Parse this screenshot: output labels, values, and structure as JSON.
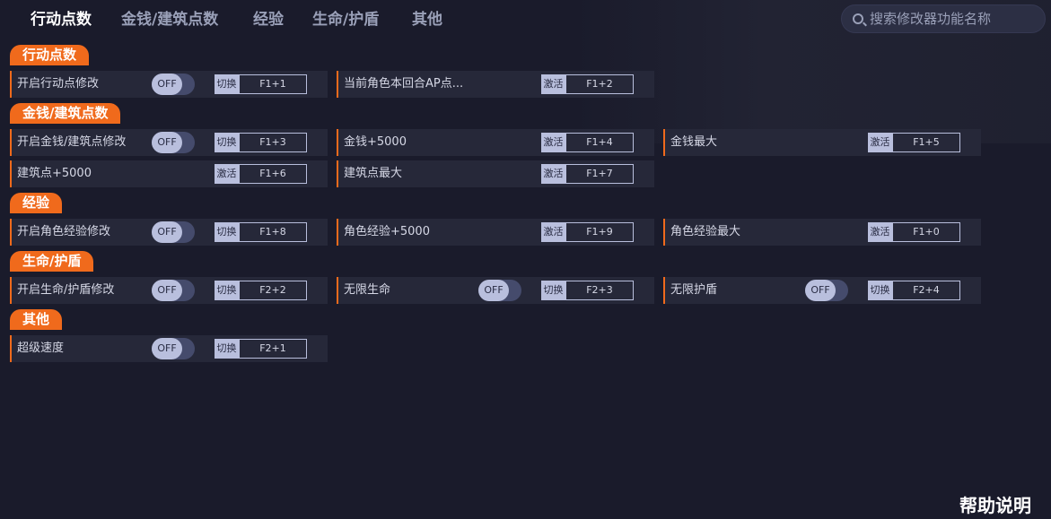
{
  "tabs": [
    "行动点数",
    "金钱/建筑点数",
    "经验",
    "生命/护盾",
    "其他"
  ],
  "search": {
    "placeholder": "搜索修改器功能名称"
  },
  "toggle_text": "OFF",
  "sections": [
    {
      "title": "行动点数",
      "rows": [
        [
          {
            "label": "开启行动点修改",
            "toggle": true,
            "type": "切换",
            "key": "F1+1"
          },
          {
            "label": "当前角色本回合AP点...",
            "toggle": false,
            "type": "激活",
            "key": "F1+2"
          }
        ]
      ]
    },
    {
      "title": "金钱/建筑点数",
      "rows": [
        [
          {
            "label": "开启金钱/建筑点修改",
            "toggle": true,
            "type": "切换",
            "key": "F1+3"
          },
          {
            "label": "金钱+5000",
            "toggle": false,
            "type": "激活",
            "key": "F1+4"
          },
          {
            "label": "金钱最大",
            "toggle": false,
            "type": "激活",
            "key": "F1+5"
          }
        ],
        [
          {
            "label": "建筑点+5000",
            "toggle": false,
            "type": "激活",
            "key": "F1+6"
          },
          {
            "label": "建筑点最大",
            "toggle": false,
            "type": "激活",
            "key": "F1+7"
          }
        ]
      ]
    },
    {
      "title": "经验",
      "rows": [
        [
          {
            "label": "开启角色经验修改",
            "toggle": true,
            "type": "切换",
            "key": "F1+8"
          },
          {
            "label": "角色经验+5000",
            "toggle": false,
            "type": "激活",
            "key": "F1+9"
          },
          {
            "label": "角色经验最大",
            "toggle": false,
            "type": "激活",
            "key": "F1+0"
          }
        ]
      ]
    },
    {
      "title": "生命/护盾",
      "rows": [
        [
          {
            "label": "开启生命/护盾修改",
            "toggle": true,
            "type": "切换",
            "key": "F2+2"
          },
          {
            "label": "无限生命",
            "toggle": true,
            "type": "切换",
            "key": "F2+3"
          },
          {
            "label": "无限护盾",
            "toggle": true,
            "type": "切换",
            "key": "F2+4"
          }
        ]
      ]
    },
    {
      "title": "其他",
      "rows": [
        [
          {
            "label": "超级速度",
            "toggle": true,
            "type": "切换",
            "key": "F2+1"
          }
        ]
      ]
    }
  ],
  "help_label": "帮助说明",
  "colors": {
    "accent": "#f06a1c",
    "background": "#1a1b2b",
    "row_bg": "#262839",
    "key_bg": "#b9bfdd"
  }
}
